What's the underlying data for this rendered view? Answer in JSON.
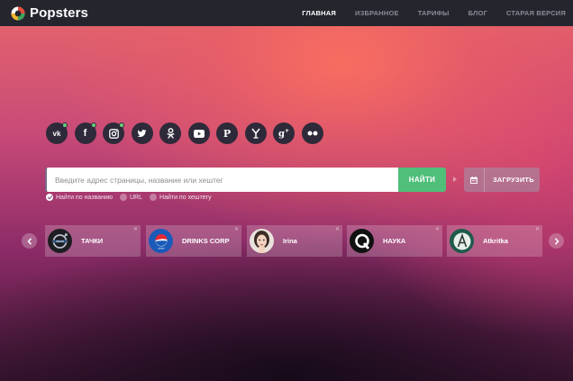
{
  "app": {
    "name": "Popsters"
  },
  "nav": {
    "items": [
      {
        "label": "ГЛАВНАЯ",
        "active": true
      },
      {
        "label": "ИЗБРАННОЕ",
        "active": false
      },
      {
        "label": "ТАРИФЫ",
        "active": false
      },
      {
        "label": "БЛОГ",
        "active": false
      },
      {
        "label": "СТАРАЯ ВЕРСИЯ",
        "active": false
      }
    ]
  },
  "socials": [
    {
      "icon": "vk-icon",
      "text": "vk",
      "badge": true
    },
    {
      "icon": "facebook-icon",
      "text": "f",
      "badge": true
    },
    {
      "icon": "instagram-icon",
      "text": "",
      "badge": true
    },
    {
      "icon": "twitter-icon",
      "text": "",
      "badge": false
    },
    {
      "icon": "odnoklassniki-icon",
      "text": "",
      "badge": false
    },
    {
      "icon": "youtube-icon",
      "text": "",
      "badge": false
    },
    {
      "icon": "pinterest-icon",
      "text": "P",
      "badge": false
    },
    {
      "icon": "ask-icon",
      "text": "",
      "badge": false
    },
    {
      "icon": "google-plus-icon",
      "text": "g+",
      "badge": false
    },
    {
      "icon": "flickr-icon",
      "text": "",
      "badge": false
    }
  ],
  "search": {
    "placeholder": "Введите адрес страницы, название или хештег",
    "value": "",
    "button_label": "НАЙТИ",
    "upload_label": "ЗАГРУЗИТЬ",
    "options": [
      {
        "label": "Найти по названию",
        "checked": true
      },
      {
        "label": "URL",
        "checked": false
      },
      {
        "label": "Найти по хештегу",
        "checked": false
      }
    ]
  },
  "cards": [
    {
      "name": "ТАЧКИ",
      "avatar": "volvo-logo"
    },
    {
      "name": "DRINKS CORP",
      "avatar": "pepsi-logo"
    },
    {
      "name": "Irina",
      "avatar": "person-photo"
    },
    {
      "name": "НАУКА",
      "avatar": "q-logo"
    },
    {
      "name": "Atkritka",
      "avatar": "a-logo"
    }
  ],
  "colors": {
    "navbar": "#24252d",
    "accent_green": "#4fbf7a",
    "badge_green": "#6ad07a"
  }
}
